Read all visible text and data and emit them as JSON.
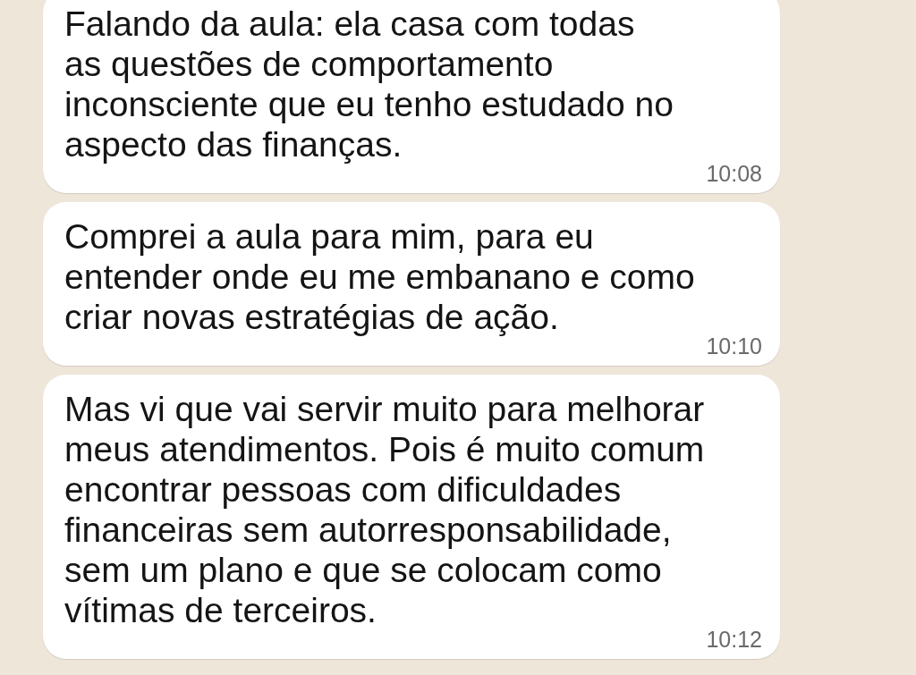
{
  "messages": [
    {
      "text": "Falando da aula: ela casa com todas\nas questões de comportamento\ninconsciente que eu tenho estudado no\naspecto das finanças.",
      "time": "10:08"
    },
    {
      "text": "Comprei a aula para mim, para eu\nentender onde eu me embanano e como\ncriar novas estratégias de ação.",
      "time": "10:10"
    },
    {
      "text": "Mas vi que vai servir muito para melhorar\nmeus atendimentos. Pois é muito comum\nencontrar pessoas com dificuldades\nfinanceiras sem autorresponsabilidade,\nsem um plano e que se colocam como\nvítimas de terceiros.",
      "time": "10:12"
    }
  ]
}
